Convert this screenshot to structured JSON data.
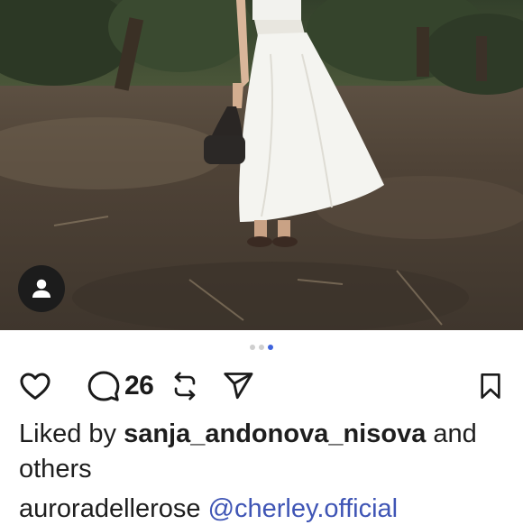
{
  "post": {
    "image_alt": "person in white skirt holding black handbag in olive grove",
    "carousel": {
      "total": 3,
      "active": 3
    },
    "tag_icon": "user-icon"
  },
  "actions": {
    "like_icon": "heart-icon",
    "comment_icon": "comment-bubble-icon",
    "comment_count": "26",
    "repost_icon": "repost-icon",
    "share_icon": "send-icon",
    "save_icon": "bookmark-icon"
  },
  "likes": {
    "prefix": "Liked by",
    "user": "sanja_andonova_nisova",
    "suffix": "and others"
  },
  "caption": {
    "username": "auroradellerose",
    "mention": "@cherley.official"
  },
  "colors": {
    "accent": "#3e63dd",
    "mention": "#3f55b5",
    "text": "#1e1e1e"
  }
}
